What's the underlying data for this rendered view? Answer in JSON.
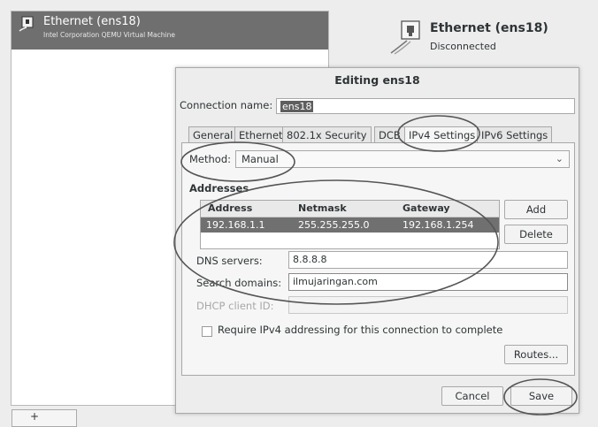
{
  "left_panel": {
    "selected_item": {
      "name": "Ethernet (ens18)",
      "description": "Intel Corporation QEMU Virtual Machine"
    },
    "bottom_button_label": "+"
  },
  "header": {
    "title": "Ethernet (ens18)",
    "status": "Disconnected"
  },
  "dialog": {
    "title": "Editing ens18",
    "connection_name_label": "Connection name:",
    "connection_name_value": "ens18",
    "tabs": [
      {
        "label": "General",
        "active": false
      },
      {
        "label": "Ethernet",
        "active": false
      },
      {
        "label": "802.1x Security",
        "active": false
      },
      {
        "label": "DCB",
        "active": false
      },
      {
        "label": "IPv4 Settings",
        "active": true
      },
      {
        "label": "IPv6 Settings",
        "active": false
      }
    ],
    "ipv4": {
      "method_label": "Method:",
      "method_value": "Manual",
      "addresses_label": "Addresses",
      "columns": [
        "Address",
        "Netmask",
        "Gateway"
      ],
      "rows": [
        {
          "address": "192.168.1.1",
          "netmask": "255.255.255.0",
          "gateway": "192.168.1.254"
        }
      ],
      "add_label": "Add",
      "delete_label": "Delete",
      "dns_label": "DNS servers:",
      "dns_value": "8.8.8.8",
      "search_label": "Search domains:",
      "search_value": "ilmujaringan.com",
      "dhcp_label": "DHCP client ID:",
      "dhcp_value": "",
      "require_label": "Require IPv4 addressing for this connection to complete",
      "routes_label": "Routes..."
    },
    "cancel_label": "Cancel",
    "save_label": "Save"
  },
  "colors": {
    "selection": "#6f6f6f",
    "annotation": "#555555"
  }
}
